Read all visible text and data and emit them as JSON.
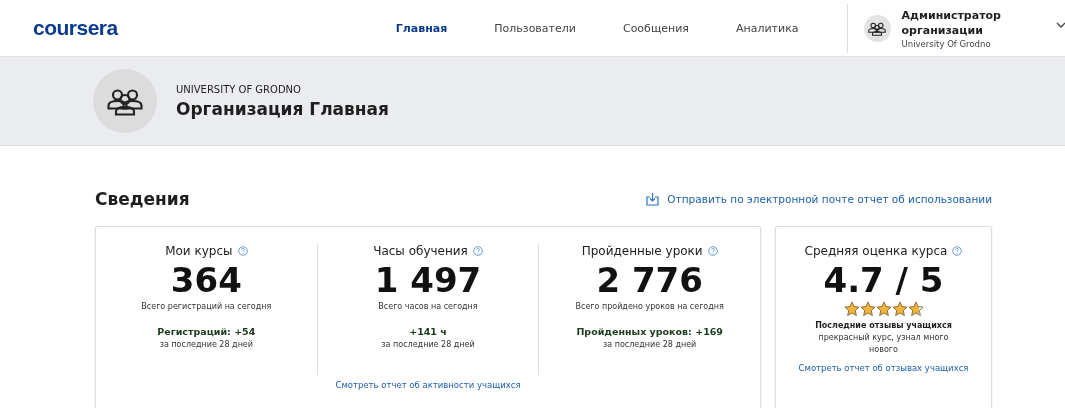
{
  "header": {
    "logo": "coursera",
    "nav": [
      {
        "label": "Главная",
        "selected": true
      },
      {
        "label": "Пользователи",
        "selected": false
      },
      {
        "label": "Сообщения",
        "selected": false
      },
      {
        "label": "Аналитика",
        "selected": false
      }
    ],
    "account": {
      "role": "Администратор организации",
      "org": "University Of Grodno"
    }
  },
  "banner": {
    "subtitle": "UNIVERSITY OF GRODNO",
    "title": "Организация Главная"
  },
  "section": {
    "title": "Сведения",
    "email_link": "Отправить по электронной почте отчет об использовании"
  },
  "stats": [
    {
      "label": "Мои курсы",
      "value": "364",
      "caption": "Всего регистраций на сегодня",
      "change": "Регистраций: +54",
      "period": "за последние 28 дней"
    },
    {
      "label": "Часы обучения",
      "value": "1 497",
      "caption": "Всего часов на сегодня",
      "change": "+141 ч",
      "period": "за последние 28 дней"
    },
    {
      "label": "Пройденные уроки",
      "value": "2 776",
      "caption": "Всего пройдено уроков на сегодня",
      "change": "Пройденных уроков: +169",
      "period": "за последние 28 дней"
    }
  ],
  "stats_link": "Смотреть отчет об активности учащихся",
  "rating": {
    "label": "Средняя оценка курса",
    "value": "4.7 / 5",
    "stars": 4.7,
    "reviews_title": "Последние отзывы учащихся",
    "review": "прекрасный курс, узнал много нового",
    "link": "Смотреть отчет об отзывах учащихся"
  }
}
